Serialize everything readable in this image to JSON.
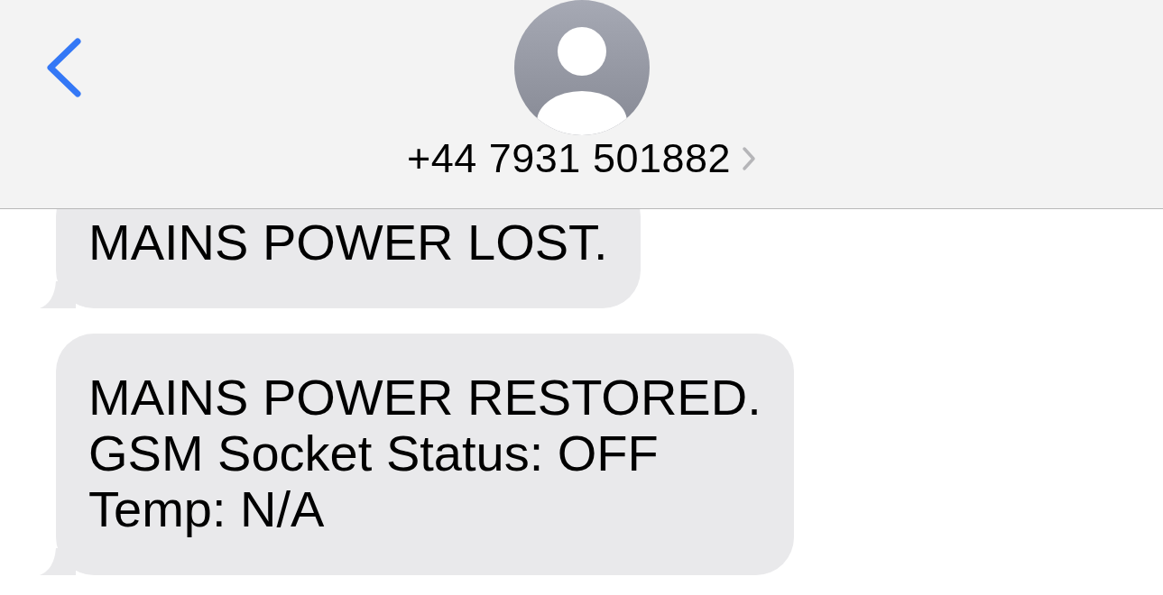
{
  "header": {
    "contact": "+44 7931 501882"
  },
  "messages": [
    {
      "text": "MAINS POWER LOST."
    },
    {
      "text": "MAINS POWER RESTORED.\nGSM Socket Status: OFF\nTemp: N/A"
    }
  ]
}
